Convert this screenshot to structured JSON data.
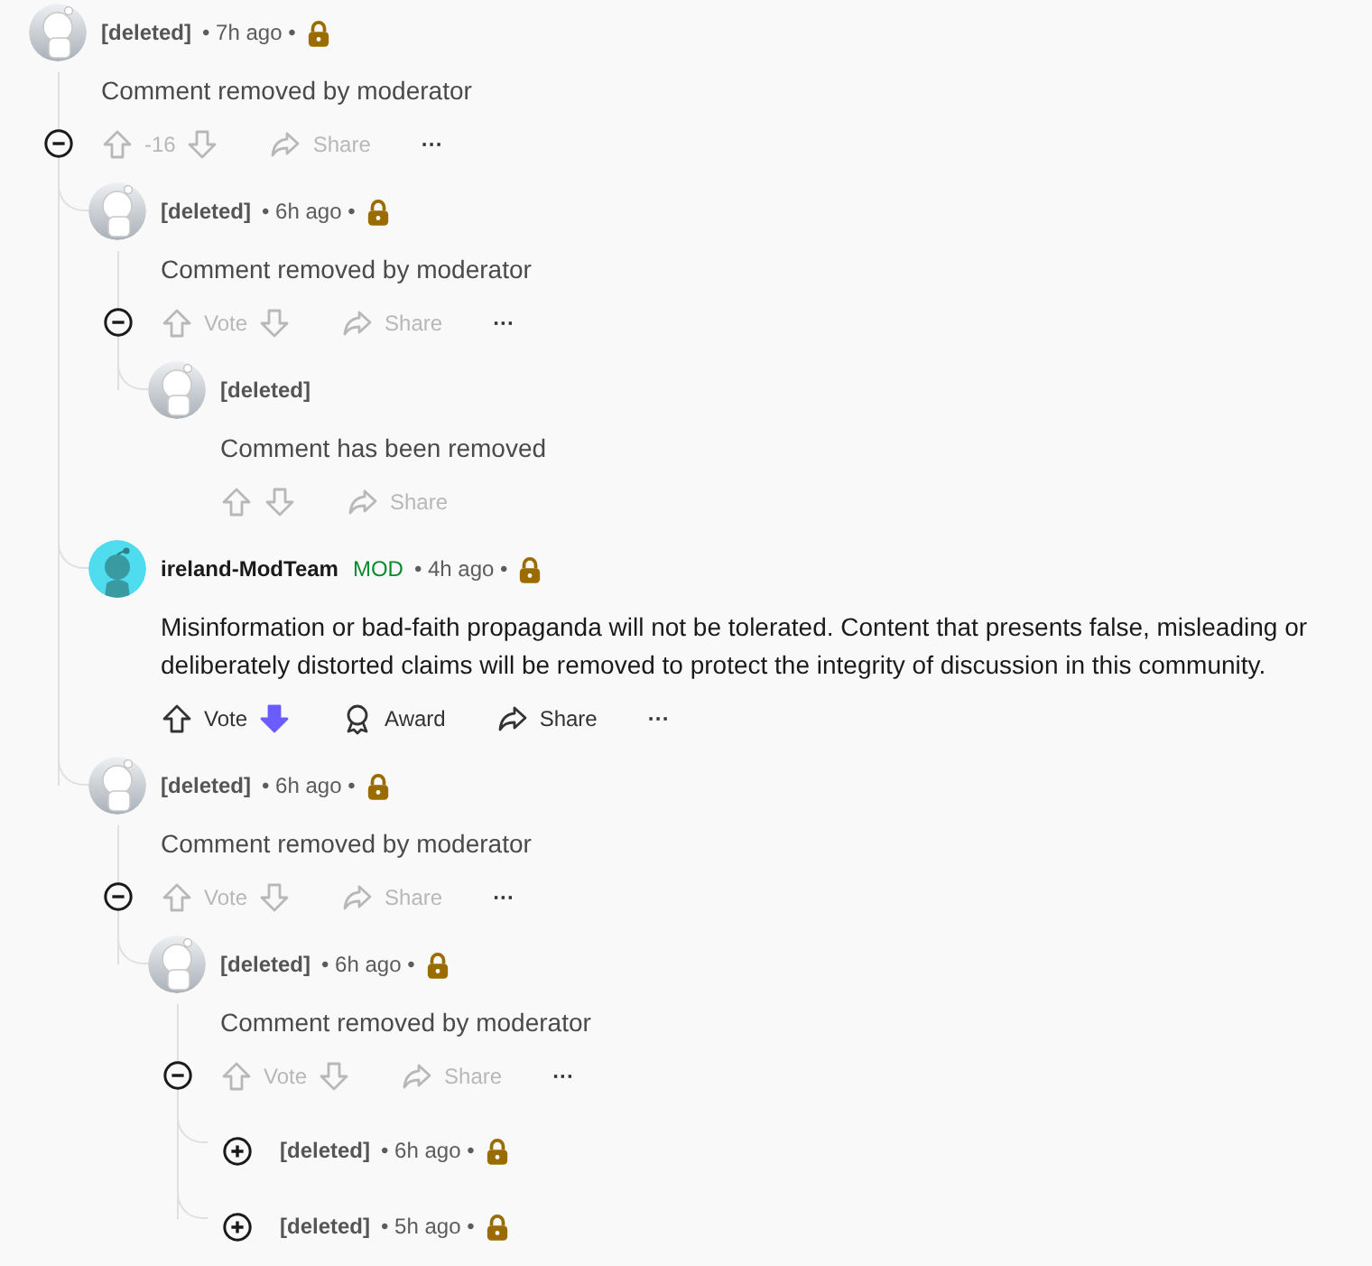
{
  "comments": [
    {
      "author": "[deleted]",
      "kind": "deleted",
      "time": "• 7h ago •",
      "locked": true,
      "expanded": true,
      "body": "Comment removed by moderator",
      "actions": {
        "disabled": true,
        "score": "-16",
        "downvoted": false,
        "share": "Share",
        "more": "···"
      },
      "children": [
        {
          "author": "[deleted]",
          "kind": "deleted",
          "time": "• 6h ago •",
          "locked": true,
          "expanded": true,
          "body": "Comment removed by moderator",
          "actions": {
            "disabled": true,
            "score": "Vote",
            "downvoted": false,
            "share": "Share",
            "more": "···"
          },
          "children": [
            {
              "author": "[deleted]",
              "kind": "deleted",
              "body": "Comment has been removed",
              "actions": {
                "disabled": true,
                "downvoted": false,
                "share": "Share"
              }
            }
          ]
        },
        {
          "author": "ireland-ModTeam",
          "kind": "mod",
          "flair": "MOD",
          "time": "• 4h ago •",
          "locked": true,
          "body": "Misinformation or bad-faith propaganda will not be tolerated. Content that presents false, misleading or deliberately distorted claims will be removed to protect the integrity of discussion in this community.",
          "actions": {
            "disabled": false,
            "score": "Vote",
            "downvoted": true,
            "award": "Award",
            "share": "Share",
            "more": "···"
          }
        },
        {
          "author": "[deleted]",
          "kind": "deleted",
          "time": "• 6h ago •",
          "locked": true,
          "expanded": true,
          "body": "Comment removed by moderator",
          "actions": {
            "disabled": true,
            "score": "Vote",
            "downvoted": false,
            "share": "Share",
            "more": "···"
          },
          "children": [
            {
              "author": "[deleted]",
              "kind": "deleted",
              "time": "• 6h ago •",
              "locked": true,
              "expanded": true,
              "body": "Comment removed by moderator",
              "actions": {
                "disabled": true,
                "score": "Vote",
                "downvoted": false,
                "share": "Share",
                "more": "···"
              },
              "children": [
                {
                  "author": "[deleted]",
                  "time": "• 6h ago •",
                  "locked": true,
                  "expanded": false
                },
                {
                  "author": "[deleted]",
                  "time": "• 5h ago •",
                  "locked": true,
                  "expanded": false
                }
              ]
            }
          ]
        }
      ]
    }
  ]
}
